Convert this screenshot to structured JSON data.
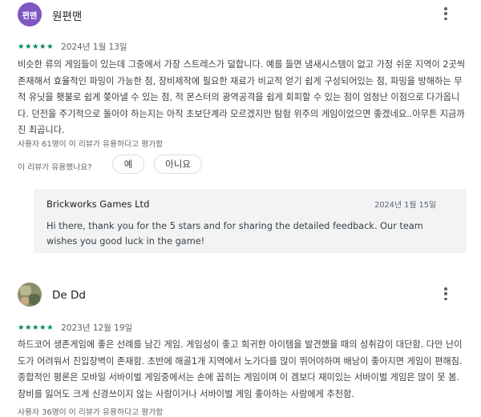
{
  "reviews": [
    {
      "avatar_text": "편맨",
      "author": "원편맨",
      "stars": "★★★★★",
      "rating": 5,
      "date": "2024년 1월 13일",
      "text": "비슷한 류의 게임들이 있는데 그중에서 가장 스트레스가 덜합니다. 예를 들면 냄새시스템이 없고 가정 쉬운 지역이 2곳씩 존재해서 효율적인 파밍이 가능한 점, 장비제작에 필요한 재료가 비교적 얻기 쉽게 구성되어있는 점, 파밍을 방해하는 무적 유닛을 횃불로 쉽게 쫒아낼 수 있는 점, 적 몬스터의 광역공격을 쉽게 회피할 수 있는 점이 엄청난 이점으로 다가옵니다. 던전을 주기적으로 돌아야 하는지는 아직 초보단계라 모르겠지만 탐험 위주의 게임이었으면 좋겠네요..아무튼 지금까진 최곱니다.",
      "helpful_count": "사용자 61명이 이 리뷰가 유용하다고 평가함",
      "helpful_question": "이 리뷰가 유용했나요?",
      "yes_label": "예",
      "no_label": "아니요",
      "developer_reply": {
        "name": "Brickworks Games Ltd",
        "date": "2024년 1월 15일",
        "text": "Hi there, thank you for the 5 stars and for sharing the detailed feedback. Our team wishes you good luck in the game!"
      }
    },
    {
      "author": "De Dd",
      "stars": "★★★★★",
      "rating": 5,
      "date": "2023년 12월 19일",
      "text": "하드코어 생존게임에 좋은 선례를 남긴 게임. 게임성이 좋고 희귀한 아이템을 발견했을 때의 성취감이 대단함. 다만 난이도가 어려워서 진입장벽이 존재함. 초반에 해골1개 지역에서 노가다를 많이 뛰어야하며 배낭이 좋아지면 게임이 편해짐. 종합적인 평론은 모바일 서바이벌 게임중에서는 손에 꼽히는 게임이며 이 겜보다 재미있는 서바이벌 게임은 많이 못 봄. 장비를 잃어도 크게 신경쓰이지 않는 사람이거나 서바이벌 게임 좋아하는 사람에게 추천함.",
      "helpful_count": "사용자 36명이 이 리뷰가 유용하다고 평가함"
    }
  ],
  "colors": {
    "star_green": "#01875f",
    "avatar_purple": "#7e57c2",
    "reply_background": "#f1f3f4"
  },
  "icons": {
    "more": "more-vert-icon"
  }
}
